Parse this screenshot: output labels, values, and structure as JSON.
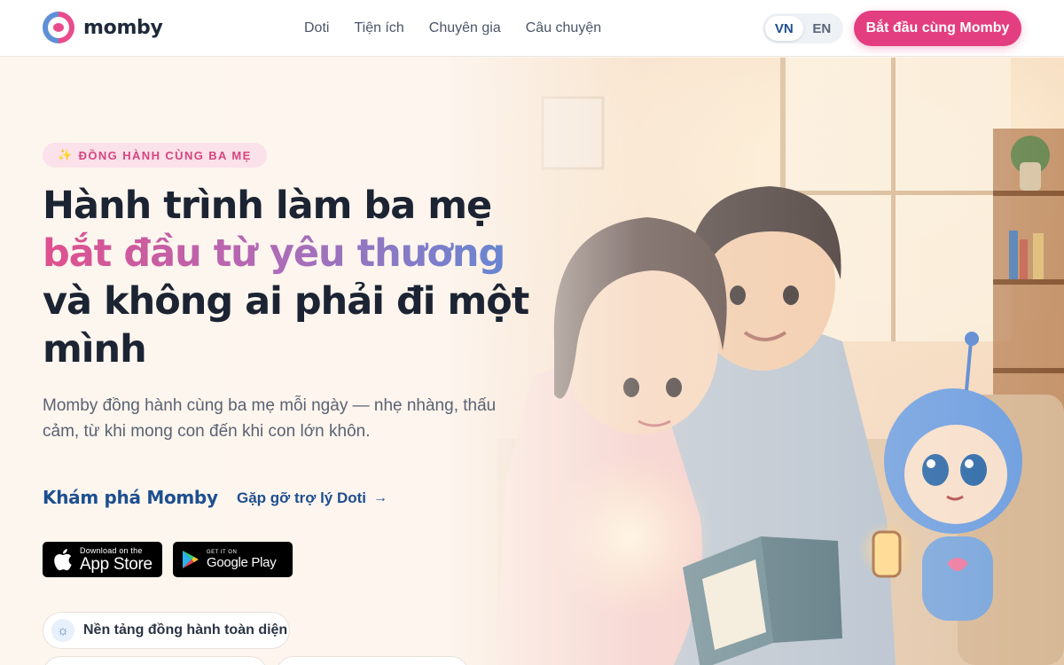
{
  "header": {
    "brand": "momby",
    "nav": [
      "Doti",
      "Tiện ích",
      "Chuyên gia",
      "Câu chuyện"
    ],
    "languages": {
      "vn": "VN",
      "en": "EN",
      "active": "VN"
    },
    "cta": "Bắt đầu cùng Momby"
  },
  "hero": {
    "badge_spark": "✨",
    "badge": "ĐỒNG HÀNH CÙNG BA MẸ",
    "headline_line1": "Hành trình làm ba mẹ",
    "headline_line2": "bắt đầu từ yêu thương",
    "headline_line3": "và không ai phải đi một",
    "headline_line4": "mình",
    "subtitle": "Momby đồng hành cùng ba mẹ mỗi ngày — nhẹ nhàng, thấu cảm, từ khi mong con đến khi con lớn khôn.",
    "link_primary": "Khám phá Momby",
    "link_secondary": "Gặp gỡ trợ lý Doti",
    "arrow": "→",
    "app_store": {
      "small": "Download on the",
      "big": "App Store"
    },
    "google_play": {
      "small": "GET IT ON",
      "big": "Google Play"
    },
    "feature_pill": "Nền tảng đồng hành toàn diện"
  },
  "colors": {
    "brand_pink": "#e33e7f",
    "brand_blue": "#1d4f8f",
    "gradient": [
      "#e0508e",
      "#b16ab6",
      "#5d8ad6"
    ],
    "background": "#fdf6ef"
  },
  "icons": {
    "pill": "sun-icon",
    "apple": "apple-icon",
    "google": "google-play-icon"
  }
}
